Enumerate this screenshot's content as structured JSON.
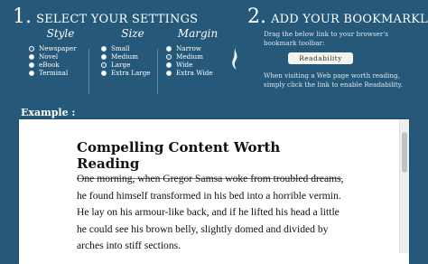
{
  "section1": {
    "number": "1.",
    "title": "SELECT YOUR SETTINGS"
  },
  "section2": {
    "number": "2.",
    "title": "ADD YOUR BOOKMARKLET"
  },
  "settings": {
    "style": {
      "heading": "Style",
      "options": [
        "Newspaper",
        "Novel",
        "eBook",
        "Terminal"
      ],
      "selected": "Newspaper"
    },
    "size": {
      "heading": "Size",
      "options": [
        "Small",
        "Medium",
        "Large",
        "Extra Large"
      ],
      "selected": "Large"
    },
    "margin": {
      "heading": "Margin",
      "options": [
        "Narrow",
        "Medium",
        "Wide",
        "Extra Wide"
      ],
      "selected": "Medium"
    }
  },
  "bookmarklet": {
    "drag_instructions": "Drag the below link to your browser's bookmark toolbar:",
    "button_label": "Readability",
    "usage_instructions": "When visiting a Web page worth reading, simply click the link to enable Readability."
  },
  "example": {
    "label": "Example :",
    "article_title": "Compelling Content Worth Reading",
    "article_body": "One morning, when Gregor Samsa woke from troubled dreams, he found himself transformed in his bed into a horrible vermin. He lay on his armour-like back, and if he lifted his head a little he could see his brown belly, slightly domed and divided by arches into stiff sections."
  },
  "colors": {
    "background": "#255879",
    "preview_bg": "#ffffff",
    "accent_radio": "#2d6ca0"
  },
  "icons": {
    "bookmarklet": "flame-icon"
  }
}
